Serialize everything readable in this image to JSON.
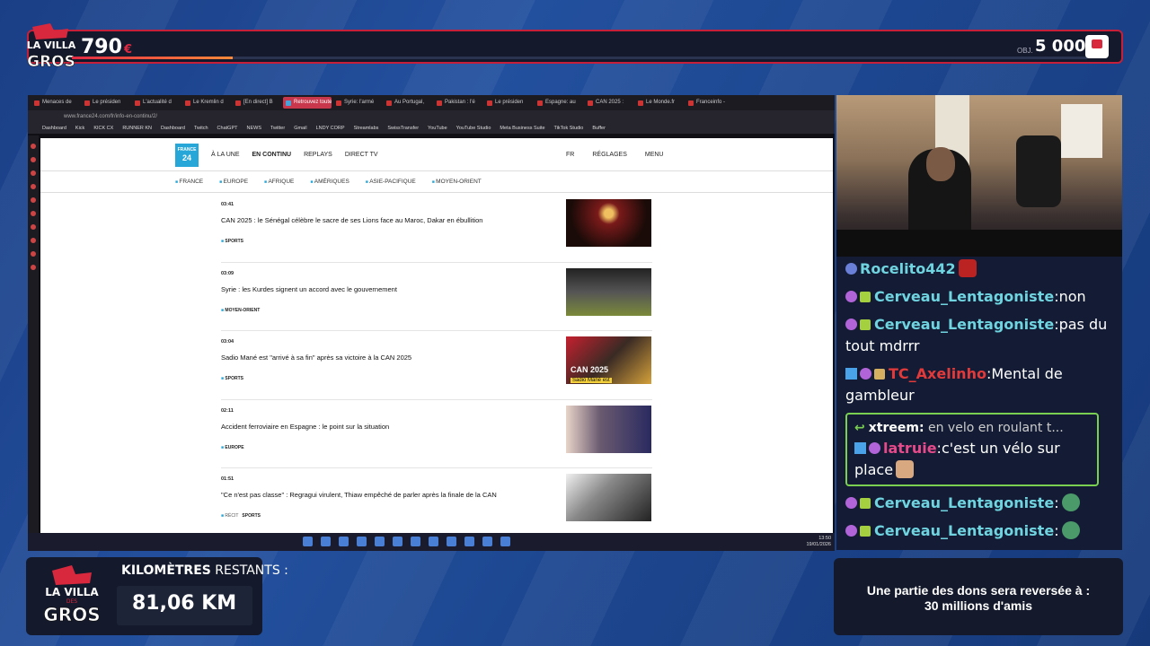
{
  "overlay": {
    "logo_text": [
      "LA VILLA",
      "DES",
      "GROS"
    ],
    "donation_amount": "790",
    "donation_currency": "€",
    "donation_progress": 0.158,
    "objective_label": "OBJ.",
    "objective_value": "5 000",
    "objective_currency": "€",
    "km_label_bold": "KILOMÈTRES",
    "km_label_rest": " RESTANTS :",
    "km_value": "81,06 KM",
    "dons_text": "Une partie des dons sera reversée à :",
    "dons_beneficiary": "30 millions d'amis"
  },
  "browser": {
    "tabs": [
      "Menaces de",
      "Le présiden",
      "L'actualité d",
      "Le Kremlin d",
      "[En direct] B",
      "Retrouvez toute l'actu",
      "Syrie: l'armé",
      "Au Portugal,",
      "Pakistan : l'é",
      "Le présiden",
      "Espagne: au",
      "CAN 2025 :",
      "Le Monde.fr",
      "Franceinfo -"
    ],
    "active_tab": 5,
    "url": "www.france24.com/fr/info-en-continu/2/",
    "bookmarks": [
      "Dashboard",
      "Kick",
      "KICK CX",
      "RUNNER KN",
      "Dashboard",
      "Twitch",
      "ChatGPT",
      "NEWS",
      "Twitter",
      "Gmail",
      "LNDY CORP",
      "Streamlabs",
      "SwissTransfer",
      "YouTube",
      "YouTube Studio",
      "Meta Business Suite",
      "TikTok Studio",
      "Buffer"
    ]
  },
  "site": {
    "logo": [
      "FRANCE",
      "24"
    ],
    "nav": [
      "À LA UNE",
      "EN CONTINU",
      "REPLAYS",
      "DIRECT TV"
    ],
    "lang": "FR",
    "settings": "RÉGLAGES",
    "menu": "MENU",
    "regions": [
      "FRANCE",
      "EUROPE",
      "AFRIQUE",
      "AMÉRIQUES",
      "ASIE-PACIFIQUE",
      "MOYEN-ORIENT"
    ],
    "articles": [
      {
        "time": "03:41",
        "title": "CAN 2025 : le Sénégal célèbre le sacre de ses Lions face au Maroc, Dakar en ébullition",
        "pre": "",
        "tag": "SPORTS"
      },
      {
        "time": "03:09",
        "title": "Syrie : les Kurdes signent un accord avec le gouvernement",
        "pre": "",
        "tag": "MOYEN-ORIENT"
      },
      {
        "time": "03:04",
        "title": "Sadio Mané est \"arrivé à sa fin\" après sa victoire à la CAN 2025",
        "pre": "",
        "tag": "SPORTS",
        "thumb_caption": "CAN 2025",
        "thumb_sub": "Sadio Mané est"
      },
      {
        "time": "02:11",
        "title": "Accident ferroviaire en Espagne : le point sur la situation",
        "pre": "",
        "tag": "EUROPE"
      },
      {
        "time": "01:51",
        "title": "\"Ce n'est pas classe\" : Regragui virulent, Thiaw empêché de parler après la finale de la CAN",
        "pre": "RÉCIT",
        "tag": "SPORTS"
      }
    ]
  },
  "taskbar": {
    "time": "13:50",
    "date": "19/01/2026"
  },
  "chat": [
    {
      "user": "Rocelito442",
      "color": "u-teal",
      "text": ""
    },
    {
      "user": "Cerveau_Lentagoniste",
      "color": "u-teal",
      "text": "non"
    },
    {
      "user": "Cerveau_Lentagoniste",
      "color": "u-teal",
      "text": "pas du tout mdrrr"
    },
    {
      "user": "TC_Axelinho",
      "color": "u-red",
      "text": "Mental de gambleur"
    },
    {
      "reply_user": "xtreem:",
      "reply_text": "en velo en roulant t...",
      "user": "latruie",
      "color": "u-pink",
      "text": "c'est un vélo sur place"
    },
    {
      "user": "Cerveau_Lentagoniste",
      "color": "u-teal",
      "text": ""
    },
    {
      "user": "Cerveau_Lentagoniste",
      "color": "u-teal",
      "text": ""
    }
  ]
}
